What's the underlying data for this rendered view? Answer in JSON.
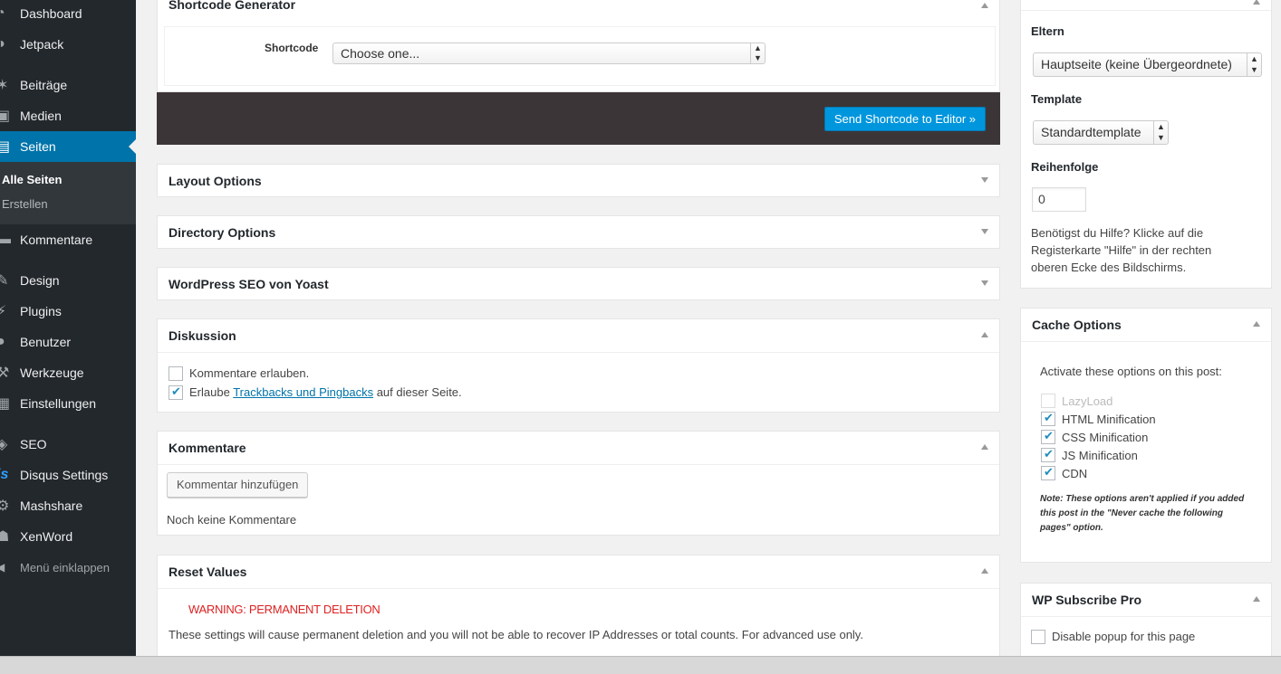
{
  "sidebar": {
    "items": [
      {
        "label": "Dashboard",
        "icon": "dashboard-icon",
        "glyph": "◔"
      },
      {
        "label": "Jetpack",
        "icon": "jetpack-icon",
        "glyph": "◑"
      },
      {
        "label": "Beiträge",
        "icon": "pin-icon",
        "glyph": "✶"
      },
      {
        "label": "Medien",
        "icon": "media-icon",
        "glyph": "▣"
      },
      {
        "label": "Seiten",
        "icon": "pages-icon",
        "glyph": "▤"
      },
      {
        "label": "Kommentare",
        "icon": "comment-icon",
        "glyph": "▬"
      },
      {
        "label": "Design",
        "icon": "brush-icon",
        "glyph": "✎"
      },
      {
        "label": "Plugins",
        "icon": "plugin-icon",
        "glyph": "⚡"
      },
      {
        "label": "Benutzer",
        "icon": "user-icon",
        "glyph": "●"
      },
      {
        "label": "Werkzeuge",
        "icon": "wrench-icon",
        "glyph": "⚒"
      },
      {
        "label": "Einstellungen",
        "icon": "settings-icon",
        "glyph": "▦"
      },
      {
        "label": "SEO",
        "icon": "seo-icon",
        "glyph": "◈"
      },
      {
        "label": "Disqus Settings",
        "icon": "disqus-icon",
        "glyph": "js"
      },
      {
        "label": "Mashshare",
        "icon": "gear-icon",
        "glyph": "⚙"
      },
      {
        "label": "XenWord",
        "icon": "group-icon",
        "glyph": "☗"
      }
    ],
    "submenu": [
      "Alle Seiten",
      "Erstellen"
    ],
    "collapse_label": "Menü einklappen",
    "collapse_glyph": "◀"
  },
  "shortcode": {
    "title": "Shortcode Generator",
    "label": "Shortcode",
    "select_value": "Choose one...",
    "send_button": "Send Shortcode to Editor »"
  },
  "boxes": {
    "layout": "Layout Options",
    "directory": "Directory Options",
    "seo": "WordPress SEO von Yoast"
  },
  "discussion": {
    "title": "Diskussion",
    "allow_comments": "Kommentare erlauben.",
    "allow_trackbacks_prefix": "Erlaube",
    "allow_trackbacks_link": "Trackbacks und Pingbacks",
    "allow_trackbacks_suffix": "auf dieser Seite."
  },
  "comments": {
    "title": "Kommentare",
    "add_button": "Kommentar hinzufügen",
    "empty": "Noch keine Kommentare"
  },
  "reset": {
    "title": "Reset Values",
    "warning": "WARNING: PERMANENT DELETION",
    "description": "These settings will cause permanent deletion and you will not be able to recover IP Addresses or total counts. For advanced use only."
  },
  "attributes": {
    "parent_label": "Eltern",
    "parent_value": "Hauptseite (keine Übergeordnete)",
    "template_label": "Template",
    "template_value": "Standardtemplate",
    "order_label": "Reihenfolge",
    "order_value": "0",
    "help": "Benötigst du Hilfe? Klicke auf die Registerkarte \"Hilfe\" in der rechten oberen Ecke des Bildschirms."
  },
  "cache": {
    "title": "Cache Options",
    "intro": "Activate these options on this post:",
    "options": [
      {
        "label": "LazyLoad",
        "checked": false,
        "disabled": true
      },
      {
        "label": "HTML Minification",
        "checked": true,
        "disabled": false
      },
      {
        "label": "CSS Minification",
        "checked": true,
        "disabled": false
      },
      {
        "label": "JS Minification",
        "checked": true,
        "disabled": false
      },
      {
        "label": "CDN",
        "checked": true,
        "disabled": false
      }
    ],
    "note": "Note: These options aren't applied if you added this post in the \"Never cache the following pages\" option."
  },
  "subscribe": {
    "title": "WP Subscribe Pro",
    "disable_popup": "Disable popup for this page"
  },
  "colors": {
    "sidebar_bg": "#23282d",
    "active_bg": "#0073aa",
    "primary_button": "#0096dd",
    "warning": "#dd2222"
  }
}
